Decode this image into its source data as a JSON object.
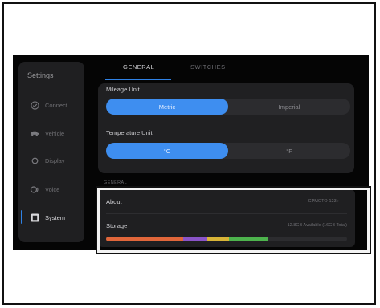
{
  "sidebar": {
    "title": "Settings",
    "items": [
      {
        "label": "Connect",
        "icon": "check-circle-icon"
      },
      {
        "label": "Vehicle",
        "icon": "car-icon"
      },
      {
        "label": "Display",
        "icon": "sun-icon"
      },
      {
        "label": "Voice",
        "icon": "voice-icon"
      },
      {
        "label": "System",
        "icon": "system-icon",
        "active": true
      }
    ]
  },
  "tabs": [
    {
      "label": "GENERAL",
      "active": true
    },
    {
      "label": "SWITCHES",
      "active": false
    }
  ],
  "mileage": {
    "label": "Mileage Unit",
    "options": [
      "Metric",
      "Imperial"
    ],
    "selected": "Metric"
  },
  "temperature": {
    "label": "Temperature Unit",
    "options": [
      "°C",
      "°F"
    ],
    "selected": "°C"
  },
  "section_label": "GENERAL",
  "about": {
    "label": "About",
    "value": "CPMOTO-123  ›"
  },
  "storage": {
    "label": "Storage",
    "value": "12.8GB Available (16GB Total)",
    "segments": [
      {
        "fraction": 0.32,
        "color": "#e0663a"
      },
      {
        "fraction": 0.1,
        "color": "#8a54c8"
      },
      {
        "fraction": 0.09,
        "color": "#d8b437"
      },
      {
        "fraction": 0.16,
        "color": "#4db34d"
      }
    ]
  },
  "colors": {
    "accent": "#3e8ef0",
    "background": "#050505",
    "panel": "#202022"
  }
}
